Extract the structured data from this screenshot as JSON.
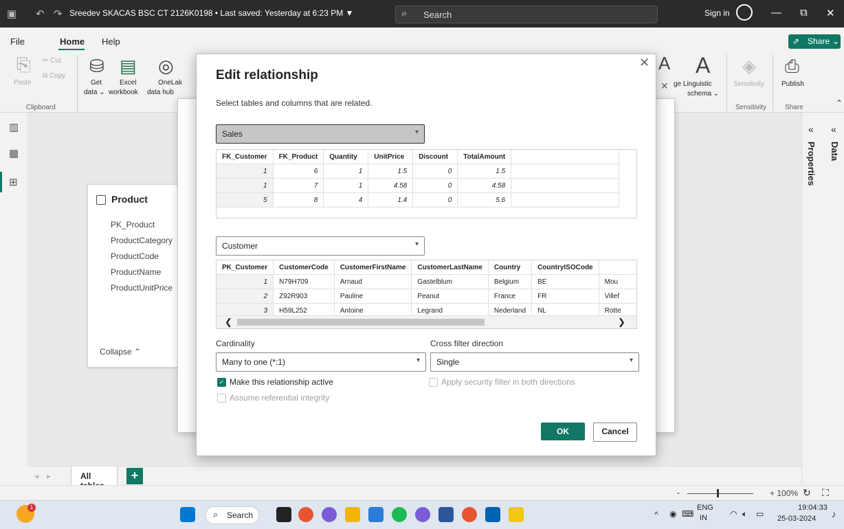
{
  "titlebar": {
    "doc_title": "Sreedev SKACAS BSC CT 2126K0198 • Last saved: Yesterday at 6:23 PM ▼",
    "search_placeholder": "Search",
    "sign_in": "Sign in",
    "minimize": "—",
    "restore": "⧉",
    "close": "✕"
  },
  "menu": {
    "file": "File",
    "home": "Home",
    "help": "Help",
    "share": "Share"
  },
  "ribbon": {
    "paste": "Paste",
    "cut": "Cut",
    "copy": "Copy",
    "clipboard_group": "Clipboard",
    "get_data": "Get",
    "get_data2": "data ⌄",
    "excel": "Excel",
    "excel2": "workbook",
    "onelake": "OneLak",
    "onelake2": "data hub",
    "linguistic": "ge Linguistic",
    "linguistic2": "schema ⌄",
    "sensitivity": "Sensitivity",
    "sensitivity_group": "Sensitivity",
    "publish": "Publish",
    "share_group": "Share"
  },
  "right_panes": {
    "properties": "Properties",
    "data": "Data"
  },
  "product_card": {
    "title": "Product",
    "fields": [
      "PK_Product",
      "ProductCategory",
      "ProductCode",
      "ProductName",
      "ProductUnitPrice"
    ],
    "collapse": "Collapse ⌃"
  },
  "tabs": {
    "all_tables": "All tables",
    "add": "+"
  },
  "statusbar": {
    "zoom": "+ 100%"
  },
  "dialog": {
    "title": "Edit relationship",
    "subtitle": "Select tables and columns that are related.",
    "table1": {
      "selected": "Sales",
      "columns": [
        "FK_Customer",
        "FK_Product",
        "Quantity",
        "UnitPrice",
        "Discount",
        "TotalAmount"
      ],
      "rows": [
        [
          "1",
          "6",
          "1",
          "1.5",
          "0",
          "1.5"
        ],
        [
          "1",
          "7",
          "1",
          "4.58",
          "0",
          "4.58"
        ],
        [
          "5",
          "8",
          "4",
          "1.4",
          "0",
          "5.6"
        ]
      ]
    },
    "table2": {
      "selected": "Customer",
      "columns": [
        "PK_Customer",
        "CustomerCode",
        "CustomerFirstName",
        "CustomerLastName",
        "Country",
        "CountryISOCode",
        ""
      ],
      "rows": [
        [
          "1",
          "N79H709",
          "Arnaud",
          "Gastelblum",
          "Belgium",
          "BE",
          "Mou"
        ],
        [
          "2",
          "Z92R903",
          "Pauline",
          "Peanut",
          "France",
          "FR",
          "Villef"
        ],
        [
          "3",
          "H59L252",
          "Antoine",
          "Legrand",
          "Nederland",
          "NL",
          "Rotte"
        ]
      ]
    },
    "cardinality_label": "Cardinality",
    "cardinality_value": "Many to one (*:1)",
    "cross_filter_label": "Cross filter direction",
    "cross_filter_value": "Single",
    "make_active": "Make this relationship active",
    "security_filter": "Apply security filter in both directions",
    "referential_integrity": "Assume referential integrity",
    "ok": "OK",
    "cancel": "Cancel"
  },
  "taskbar": {
    "search": "Search",
    "lang1": "ENG",
    "lang2": "IN",
    "time": "19:04:33",
    "date": "25-03-2024"
  }
}
